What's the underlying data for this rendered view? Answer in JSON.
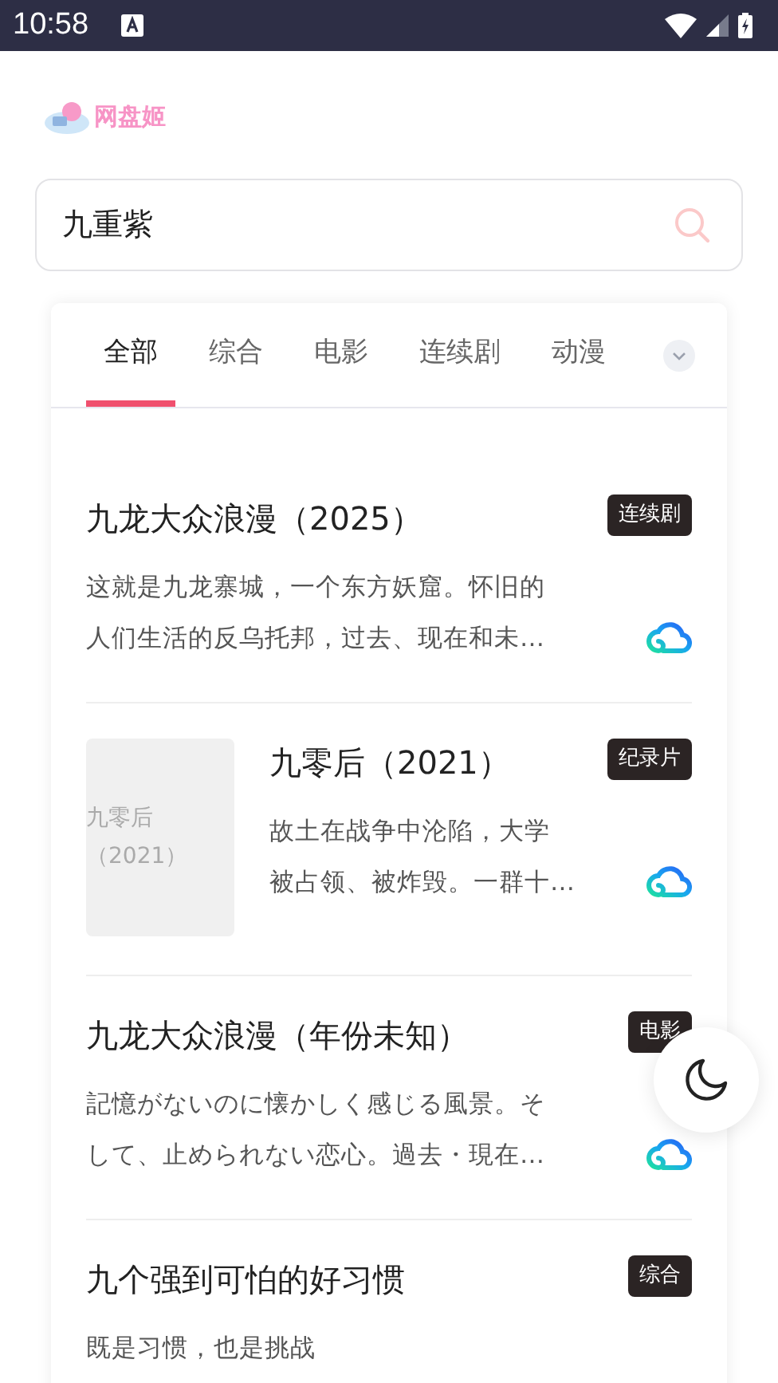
{
  "status_bar": {
    "time": "10:58"
  },
  "logo": {
    "text": "网盘姬"
  },
  "search": {
    "value": "九重紫"
  },
  "tabs": [
    {
      "label": "全部",
      "selected": true
    },
    {
      "label": "综合",
      "selected": false
    },
    {
      "label": "电影",
      "selected": false
    },
    {
      "label": "连续剧",
      "selected": false
    },
    {
      "label": "动漫",
      "selected": false
    }
  ],
  "results": [
    {
      "title": "九龙大众浪漫（2025）",
      "tag": "连续剧",
      "description_lines": [
        "这就是九龙寨城，一个东方妖窟。怀旧的",
        "人们生活的反乌托邦，过去、现在和未…"
      ],
      "cloud": true
    },
    {
      "title": "九零后（2021）",
      "tag": "纪录片",
      "thumbnail": {
        "kind": "placeholder",
        "lines": [
          "九零后",
          "（2021）"
        ]
      },
      "description_lines": [
        "故土在战争中沦陷，大学",
        "被占领、被炸毁。一群十…"
      ],
      "cloud": true
    },
    {
      "title": "九龙大众浪漫（年份未知）",
      "tag": "电影",
      "description_lines": [
        "記憶がないのに懐かしく感じる風景。そ",
        "して、止められない恋心。過去・現在…"
      ],
      "cloud": true
    },
    {
      "title": "九个强到可怕的好习惯",
      "tag": "综合",
      "description_lines": [
        "既是习惯，也是挑战"
      ],
      "cloud": false
    }
  ]
}
